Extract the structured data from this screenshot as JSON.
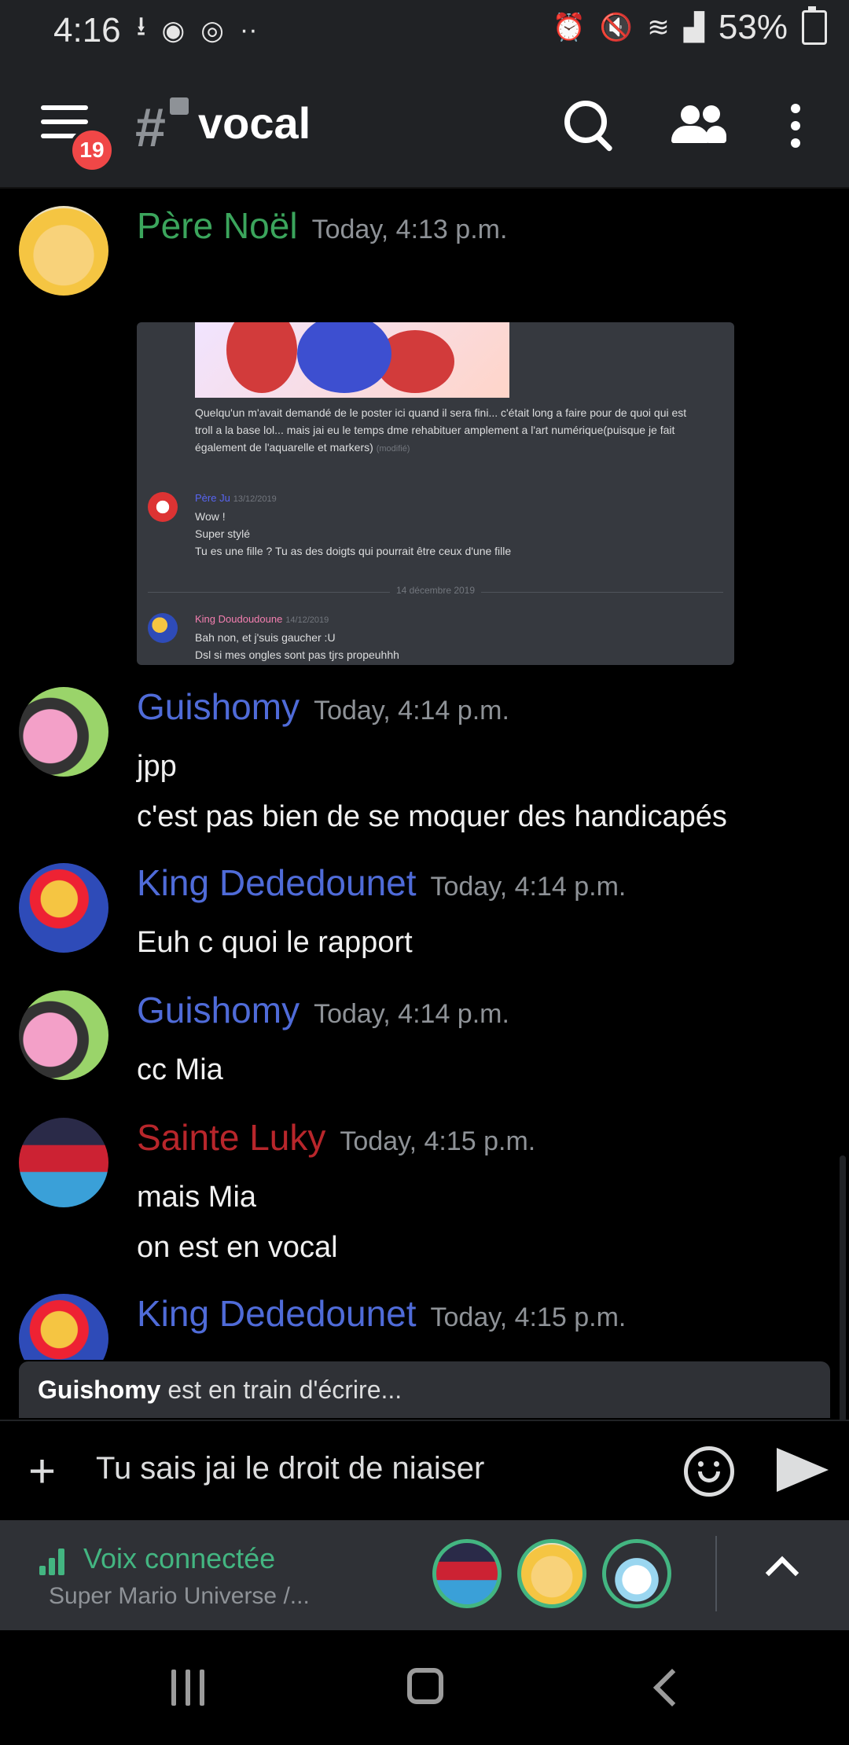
{
  "status_bar": {
    "time": "4:16",
    "battery": "53%",
    "icons": [
      "download-icon",
      "discord-icon",
      "instagram-icon",
      "more-dots-icon",
      "alarm-icon",
      "mute-icon",
      "wifi-icon",
      "signal-icon",
      "battery-icon"
    ]
  },
  "header": {
    "menu_badge": "19",
    "channel_name": "vocal",
    "icons": [
      "menu-icon",
      "hash-lock-icon",
      "search-icon",
      "members-icon",
      "overflow-icon"
    ]
  },
  "messages": [
    {
      "author": "Père Noël",
      "author_color": "#3ba55c",
      "timestamp": "Today, 4:13 p.m.",
      "embed": {
        "top_text": "Quelqu'un m'avait demandé de le poster ici quand il sera fini... c'était long a faire pour de quoi qui est troll a la base lol... mais jai eu le temps dme rehabituer amplement a l'art numérique(puisque je fait également de l'aquarelle et markers)",
        "top_text_suffix": "(modifié)",
        "reply1_author": "Père Ju",
        "reply1_date": "13/12/2019",
        "reply1_lines": [
          "Wow !",
          "Super stylé",
          "Tu es une fille ? Tu as des doigts qui pourrait être ceux d'une fille"
        ],
        "divider": "14 décembre 2019",
        "reply2_author": "King Doudoudoune",
        "reply2_date": "14/12/2019",
        "reply2_lines": [
          "Bah non, et j'suis gaucher :U",
          "Dsl si mes ongles sont pas tjrs propeuhhh"
        ]
      }
    },
    {
      "author": "Guishomy",
      "author_color": "#4f6bd8",
      "timestamp": "Today, 4:14 p.m.",
      "lines": [
        "jpp",
        "c'est pas bien de se moquer des handicapés"
      ]
    },
    {
      "author": "King Dededounet",
      "author_color": "#4f6bd8",
      "timestamp": "Today, 4:14 p.m.",
      "lines": [
        "Euh c quoi le rapport"
      ]
    },
    {
      "author": "Guishomy",
      "author_color": "#4f6bd8",
      "timestamp": "Today, 4:14 p.m.",
      "lines": [
        "cc Mia"
      ]
    },
    {
      "author": "Sainte Luky",
      "author_color": "#b8262b",
      "timestamp": "Today, 4:15 p.m.",
      "lines": [
        "mais Mia",
        "on est en vocal"
      ]
    },
    {
      "author": "King Dededounet",
      "author_color": "#4f6bd8",
      "timestamp": "Today, 4:15 p.m.",
      "lines": []
    }
  ],
  "typing": {
    "user": "Guishomy",
    "text": "est en train d'écrire..."
  },
  "composer": {
    "value": "Tu sais jai le droit de niaiser",
    "icons": [
      "plus-icon",
      "emoji-icon",
      "send-icon"
    ]
  },
  "voice": {
    "title": "Voix connectée",
    "subtitle": "Super Mario Universe /...",
    "accent": "#43b581"
  },
  "nav": {
    "icons": [
      "recent-apps-icon",
      "home-icon",
      "back-icon"
    ]
  }
}
